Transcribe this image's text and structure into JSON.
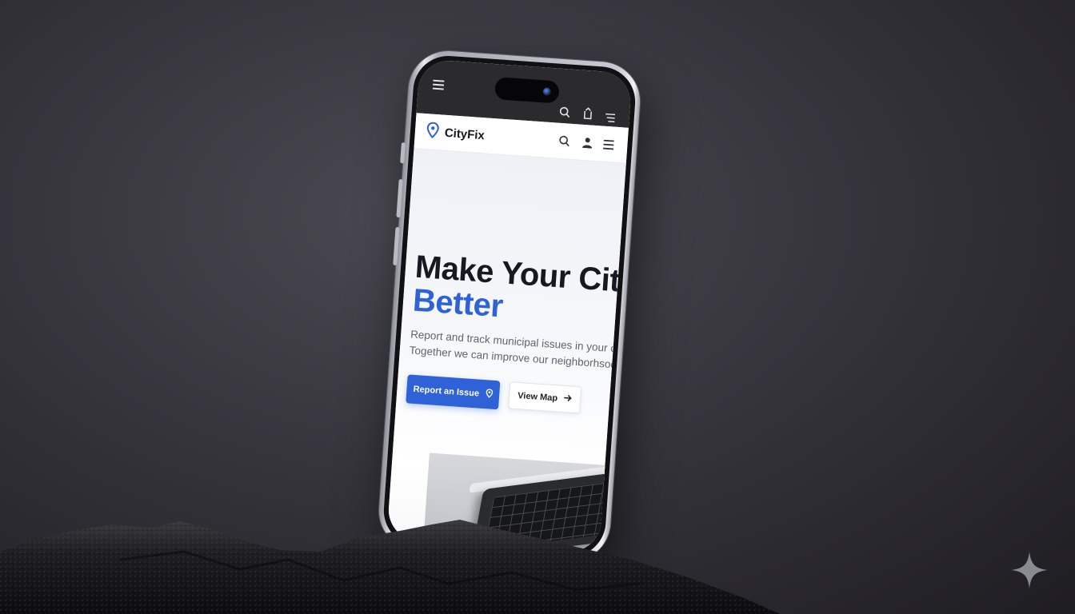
{
  "app": {
    "name": "CityFix"
  },
  "hero": {
    "title_line1": "Make Your City",
    "title_line2": "Better",
    "description_line1": "Report and track municipal issues in your comm",
    "description_line2": "Together we can improve our neighborhsods."
  },
  "actions": {
    "primary_label": "Report an Issue",
    "secondary_label": "View Map"
  },
  "icons": {
    "status_menu": "hamburger-icon",
    "status_search": "search-icon",
    "status_share": "share-icon",
    "status_filter": "filter-icon",
    "logo": "map-pin-icon",
    "header_search": "search-icon",
    "header_user": "user-icon",
    "header_menu": "menu-icon",
    "primary_button": "map-pin-icon",
    "secondary_button": "arrow-right-icon",
    "watermark": "sparkle-icon"
  },
  "colors": {
    "accent": "#2f62d6",
    "heading": "#151922",
    "body_text": "#5e636d",
    "status_bar": "#2b2b2e",
    "background": "#36353c"
  }
}
